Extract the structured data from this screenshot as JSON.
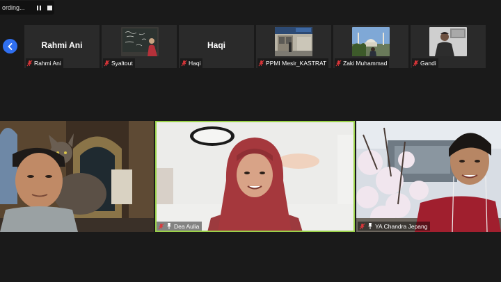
{
  "recording": {
    "text": "ording...",
    "pause_icon": "pause-icon",
    "stop_icon": "stop-icon"
  },
  "navigation": {
    "prev_icon": "chevron-left-icon"
  },
  "gallery_strip": [
    {
      "name": "Rahmi Ani",
      "label": "Rahmi Ani",
      "has_video": false,
      "muted": true
    },
    {
      "name": "Syaltout",
      "label": "Syaltout",
      "has_video": true,
      "muted": true
    },
    {
      "name": "Haqi",
      "label": "Haqi",
      "has_video": false,
      "muted": true
    },
    {
      "name": "PPMI Mesir_KASTRAT",
      "label": "PPMI Mesir_KASTRAT",
      "has_video": true,
      "muted": true
    },
    {
      "name": "Zaki Muhammad",
      "label": "Zaki Muhammad",
      "has_video": true,
      "muted": true
    },
    {
      "name": "Gandi",
      "label": "Gandi",
      "has_video": true,
      "muted": true
    }
  ],
  "main_tiles": [
    {
      "name": "",
      "label": "",
      "muted": false,
      "pinned": false,
      "active": false
    },
    {
      "name": "Dea Aulia",
      "label": "Dea Aulia",
      "muted": true,
      "pinned": true,
      "active": true
    },
    {
      "name": "YA Chandra Jepang",
      "label": "YA Chandra Jepang",
      "muted": true,
      "pinned": true,
      "active": false
    }
  ],
  "colors": {
    "background": "#1a1a1a",
    "tile_bg": "#2a2a2a",
    "active_speaker": "#9bd24a",
    "nav_button": "#2f6ff0",
    "mic_muted": "#e0363a"
  }
}
